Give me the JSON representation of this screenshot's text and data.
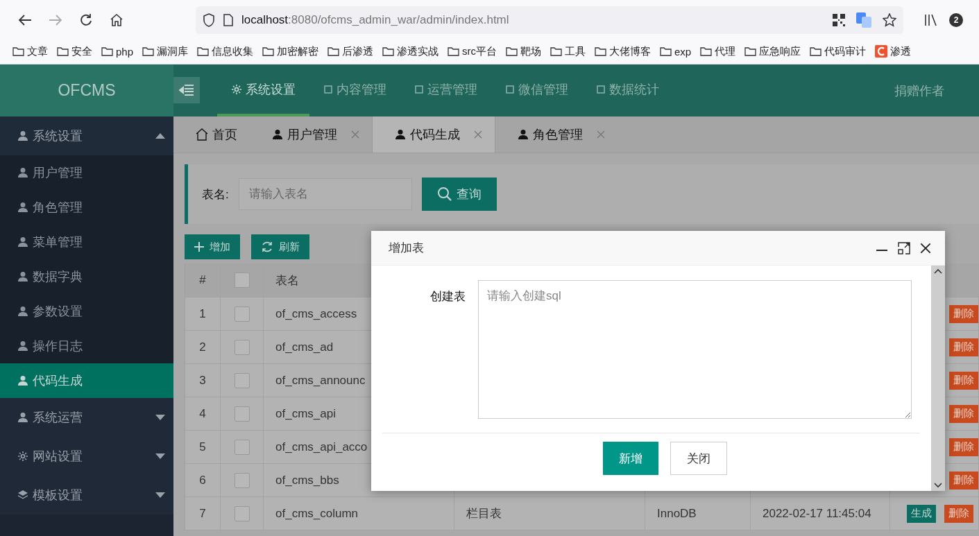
{
  "browser": {
    "url_host": "localhost",
    "url_rest": ":8080/ofcms_admin_war/admin/index.html",
    "badge": "2",
    "bookmarks": [
      {
        "label": "文章",
        "kind": "folder"
      },
      {
        "label": "安全",
        "kind": "folder"
      },
      {
        "label": "php",
        "kind": "folder"
      },
      {
        "label": "漏洞库",
        "kind": "folder"
      },
      {
        "label": "信息收集",
        "kind": "folder"
      },
      {
        "label": "加密解密",
        "kind": "folder"
      },
      {
        "label": "后渗透",
        "kind": "folder"
      },
      {
        "label": "渗透实战",
        "kind": "folder"
      },
      {
        "label": "src平台",
        "kind": "folder"
      },
      {
        "label": "靶场",
        "kind": "folder"
      },
      {
        "label": "工具",
        "kind": "folder"
      },
      {
        "label": "大佬博客",
        "kind": "folder"
      },
      {
        "label": "exp",
        "kind": "folder"
      },
      {
        "label": "代理",
        "kind": "folder"
      },
      {
        "label": "应急响应",
        "kind": "folder"
      },
      {
        "label": "代码审计",
        "kind": "folder"
      },
      {
        "label": "渗透",
        "kind": "site"
      }
    ]
  },
  "logo": "OFCMS",
  "top_nav": [
    {
      "label": "系统设置",
      "selected": true
    },
    {
      "label": "内容管理",
      "selected": false
    },
    {
      "label": "运营管理",
      "selected": false
    },
    {
      "label": "微信管理",
      "selected": false
    },
    {
      "label": "数据统计",
      "selected": false
    }
  ],
  "top_right": "捐赠作者",
  "sidebar": {
    "items": [
      {
        "label": "系统设置",
        "expanded": true,
        "children": [
          {
            "label": "用户管理",
            "selected": false
          },
          {
            "label": "角色管理",
            "selected": false
          },
          {
            "label": "菜单管理",
            "selected": false
          },
          {
            "label": "数据字典",
            "selected": false
          },
          {
            "label": "参数设置",
            "selected": false
          },
          {
            "label": "操作日志",
            "selected": false
          },
          {
            "label": "代码生成",
            "selected": true
          }
        ]
      },
      {
        "label": "系统运营",
        "expanded": false
      },
      {
        "label": "网站设置",
        "expanded": false
      },
      {
        "label": "模板设置",
        "expanded": false
      }
    ]
  },
  "tabs": [
    {
      "label": "首页",
      "selected": false,
      "closable": false
    },
    {
      "label": "用户管理",
      "selected": false,
      "closable": true
    },
    {
      "label": "代码生成",
      "selected": true,
      "closable": true
    },
    {
      "label": "角色管理",
      "selected": false,
      "closable": true
    }
  ],
  "search": {
    "label": "表名:",
    "placeholder": "请输入表名",
    "button": "查询"
  },
  "toolbar": [
    {
      "label": "增加",
      "kind": "add"
    },
    {
      "label": "刷新",
      "kind": "refresh"
    }
  ],
  "table": {
    "columns": [
      "#",
      "表名"
    ],
    "header_checked": false,
    "rows": [
      {
        "number": "1",
        "checked": false,
        "name": "of_cms_access",
        "actions": [
          {
            "label": "删除",
            "kind": "delete"
          }
        ]
      },
      {
        "number": "2",
        "checked": false,
        "name": "of_cms_ad",
        "actions": [
          {
            "label": "删除",
            "kind": "delete"
          }
        ]
      },
      {
        "number": "3",
        "checked": false,
        "name": "of_cms_announc",
        "actions": [
          {
            "label": "删除",
            "kind": "delete"
          }
        ]
      },
      {
        "number": "4",
        "checked": false,
        "name": "of_cms_api",
        "actions": [
          {
            "label": "删除",
            "kind": "delete"
          }
        ]
      },
      {
        "number": "5",
        "checked": false,
        "name": "of_cms_api_acco",
        "actions": [
          {
            "label": "删除",
            "kind": "delete"
          }
        ]
      },
      {
        "number": "6",
        "checked": false,
        "name": "of_cms_bbs",
        "actions": [
          {
            "label": "删除",
            "kind": "delete"
          }
        ]
      },
      {
        "number": "7",
        "checked": false,
        "name": "of_cms_column",
        "description": "栏目表",
        "engine": "InnoDB",
        "created": "2022-02-17 11:45:04",
        "actions": [
          {
            "label": "生成",
            "kind": "generate"
          },
          {
            "label": "删除",
            "kind": "delete"
          }
        ]
      }
    ]
  },
  "dialog": {
    "title": "增加表",
    "field_label": "创建表",
    "placeholder": "请输入创建sql",
    "buttons": [
      {
        "label": "新增",
        "kind": "primary"
      },
      {
        "label": "关闭",
        "kind": "secondary"
      }
    ]
  }
}
